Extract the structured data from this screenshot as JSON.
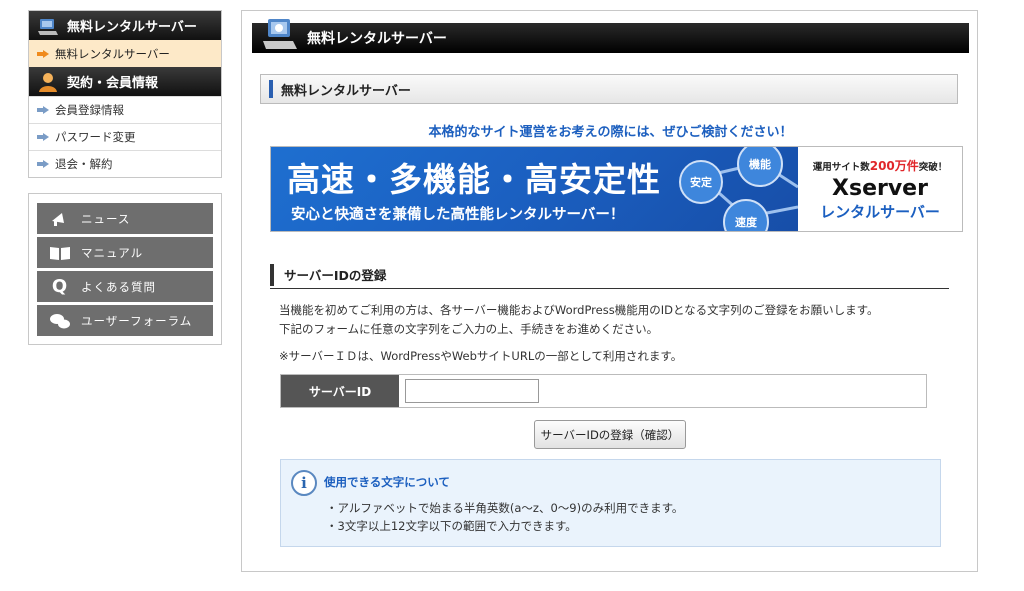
{
  "sidebar": {
    "section1_title": "無料レンタルサーバー",
    "section1_items": [
      {
        "label": "無料レンタルサーバー",
        "active": true
      }
    ],
    "section2_title": "契約・会員情報",
    "section2_items": [
      {
        "label": "会員登録情報"
      },
      {
        "label": "パスワード変更"
      },
      {
        "label": "退会・解約"
      }
    ],
    "links": [
      {
        "label": "ニュース",
        "icon": "megaphone-icon"
      },
      {
        "label": "マニュアル",
        "icon": "book-icon"
      },
      {
        "label": "よくある質問",
        "icon": "q-icon"
      },
      {
        "label": "ユーザーフォーラム",
        "icon": "chat-bubbles-icon"
      }
    ]
  },
  "main": {
    "page_title": "無料レンタルサーバー",
    "section_title": "無料レンタルサーバー",
    "promo_text": "本格的なサイト運営をお考えの際には、ぜひご検討ください！",
    "banner": {
      "headline": "高速・多機能・高安定性",
      "subline": "安心と快適さを兼備した高性能レンタルサーバー！",
      "bubbles": [
        "安定",
        "機能",
        "速度"
      ],
      "tag_prefix": "運用サイト数",
      "tag_number": "200万件",
      "tag_suffix": "突破！",
      "brand": "Xserver",
      "brand_sub": "レンタルサーバー"
    },
    "register_title": "サーバーIDの登録",
    "desc_line1": "当機能を初めてご利用の方は、各サーバー機能およびWordPress機能用のIDとなる文字列のご登録をお願いします。",
    "desc_line2": "下記のフォームに任意の文字列をご入力の上、手続きをお進めください。",
    "note": "※サーバーＩＤは、WordPressやWebサイトURLの一部として利用されます。",
    "form_label": "サーバーID",
    "form_value": "",
    "submit_label": "サーバーIDの登録（確認）",
    "info_title": "使用できる文字について",
    "info_line1": "・アルファベットで始まる半角英数(a〜z、0〜9)のみ利用できます。",
    "info_line2": "・3文字以上12文字以下の範囲で入力できます。"
  },
  "colors": {
    "accent_blue": "#1c5fbf",
    "active_bg": "#fde9c8",
    "banner_blue": "#1b5fc0",
    "red": "#e0262a"
  }
}
